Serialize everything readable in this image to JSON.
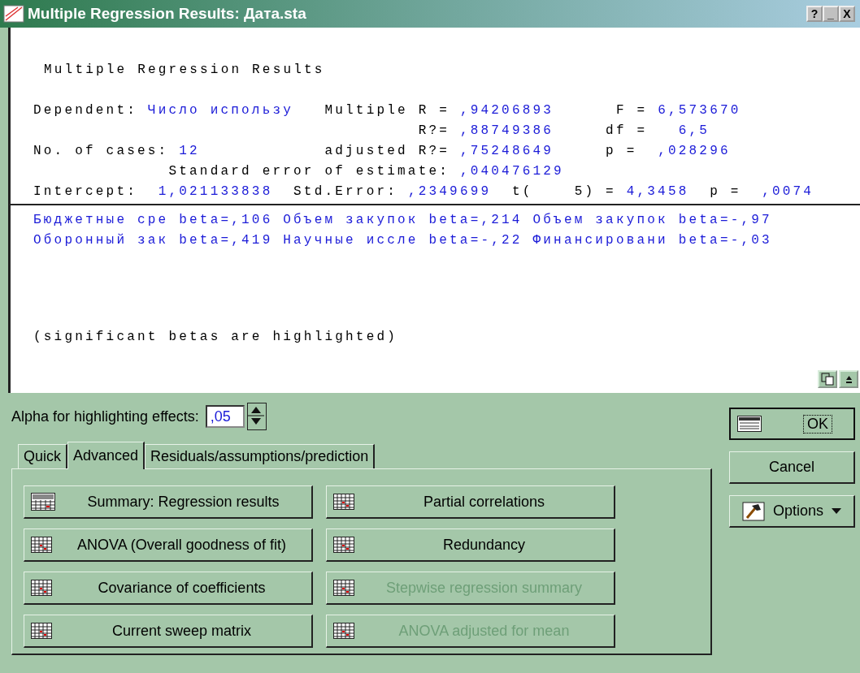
{
  "window": {
    "title": "Multiple Regression Results: Дата.sta",
    "title_buttons": [
      "?",
      "_",
      "X"
    ]
  },
  "report": {
    "heading": "Multiple Regression Results",
    "summary_lines": [
      [
        {
          "text": "Dependent: ",
          "value": false
        },
        {
          "text": "Число использу",
          "value": true
        },
        {
          "text": "   Multiple R = ",
          "value": false
        },
        {
          "text": ",94206893",
          "value": true
        },
        {
          "text": "      F = ",
          "value": false
        },
        {
          "text": "6,573670",
          "value": true
        }
      ],
      [
        {
          "text": "                                     R?= ",
          "value": false
        },
        {
          "text": ",88749386",
          "value": true
        },
        {
          "text": "     df =   ",
          "value": false
        },
        {
          "text": "6,5",
          "value": true
        }
      ],
      [
        {
          "text": "No. of cases: ",
          "value": false
        },
        {
          "text": "12",
          "value": true
        },
        {
          "text": "            adjusted R?= ",
          "value": false
        },
        {
          "text": ",75248649",
          "value": true
        },
        {
          "text": "     p =  ",
          "value": false
        },
        {
          "text": ",028296",
          "value": true
        }
      ],
      [
        {
          "text": "             Standard error of estimate: ",
          "value": false
        },
        {
          "text": ",040476129",
          "value": true
        }
      ],
      [
        {
          "text": "Intercept:  ",
          "value": false
        },
        {
          "text": "1,021133838",
          "value": true
        },
        {
          "text": "  Std.Error: ",
          "value": false
        },
        {
          "text": ",2349699",
          "value": true
        },
        {
          "text": "  t(    5) = ",
          "value": false
        },
        {
          "text": "4,3458",
          "value": true
        },
        {
          "text": "  p =  ",
          "value": false
        },
        {
          "text": ",0074",
          "value": true
        }
      ]
    ],
    "beta_lines": [
      {
        "text": "Бюджетные сре beta=,106 Объем закупок beta=,214 Объем закупок beta=-,97",
        "value": true
      },
      {
        "text": "Оборонный зак beta=,419 Научные иссле beta=-,22 Финансировани beta=-,03",
        "value": true
      }
    ],
    "footnote": "(significant betas are highlighted)"
  },
  "alpha": {
    "label": "Alpha for highlighting effects:",
    "value": ",05"
  },
  "tabs": [
    {
      "label": "Quick",
      "selected": false
    },
    {
      "label": "Advanced",
      "selected": true
    },
    {
      "label": "Residuals/assumptions/prediction",
      "selected": false
    }
  ],
  "analysis_buttons": [
    {
      "label": "Summary:  Regression results",
      "kind": "summary",
      "disabled": false
    },
    {
      "label": "Partial correlations",
      "kind": "table",
      "disabled": false
    },
    {
      "label": "ANOVA (Overall goodness of fit)",
      "kind": "table",
      "disabled": false
    },
    {
      "label": "Redundancy",
      "kind": "table",
      "disabled": false
    },
    {
      "label": "Covariance of coefficients",
      "kind": "table",
      "disabled": false
    },
    {
      "label": "Stepwise regression summary",
      "kind": "table",
      "disabled": true
    },
    {
      "label": "Current sweep matrix",
      "kind": "table",
      "disabled": false
    },
    {
      "label": "ANOVA adjusted for mean",
      "kind": "table",
      "disabled": true
    }
  ],
  "side_buttons": [
    {
      "label": "OK",
      "kind": "ok"
    },
    {
      "label": "Cancel",
      "kind": "plain"
    },
    {
      "label": "Options",
      "kind": "menu"
    }
  ]
}
